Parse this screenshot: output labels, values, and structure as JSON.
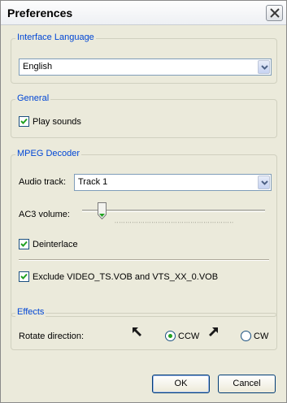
{
  "window": {
    "title": "Preferences"
  },
  "interface_language": {
    "legend": "Interface Language",
    "selected": "English"
  },
  "general": {
    "legend": "General",
    "play_sounds": {
      "label": "Play sounds",
      "checked": true
    }
  },
  "mpeg_decoder": {
    "legend": "MPEG Decoder",
    "audio_track_label": "Audio track:",
    "audio_track_value": "Track 1",
    "ac3_volume_label": "AC3 volume:",
    "ac3_volume_level": 0.1,
    "deinterlace": {
      "label": "Deinterlace",
      "checked": true
    },
    "exclude": {
      "label": "Exclude VIDEO_TS.VOB and VTS_XX_0.VOB",
      "checked": true
    }
  },
  "effects": {
    "legend": "Effects",
    "rotate_label": "Rotate direction:",
    "options": [
      {
        "label": "CCW",
        "selected": true,
        "icon": "arrow-up-left-icon"
      },
      {
        "label": "CW",
        "selected": false,
        "icon": "arrow-up-right-icon"
      }
    ]
  },
  "buttons": {
    "ok": "OK",
    "cancel": "Cancel"
  },
  "colors": {
    "legend_text": "#0046d5",
    "radio_selected": "#21a121",
    "combo_border": "#7f9db9"
  }
}
